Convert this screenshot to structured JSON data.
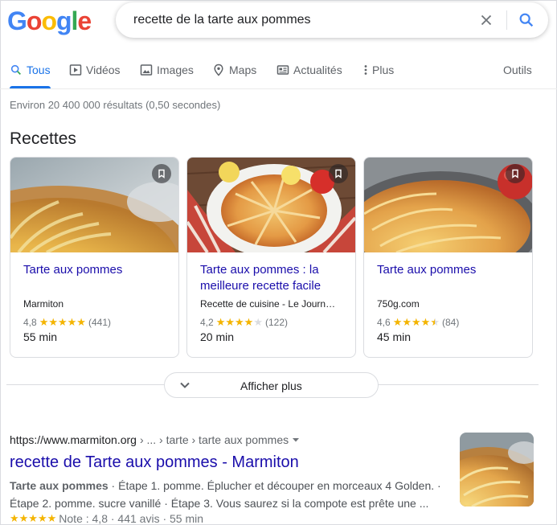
{
  "logo": {
    "letters": [
      "G",
      "o",
      "o",
      "g",
      "l",
      "e"
    ],
    "colors": [
      "#4285F4",
      "#EA4335",
      "#FBBC05",
      "#4285F4",
      "#34A853",
      "#EA4335"
    ]
  },
  "search": {
    "query": "recette de la tarte aux pommes",
    "clear_icon": "close-icon",
    "search_icon": "search-icon"
  },
  "tabs": [
    {
      "label": "Tous",
      "icon": "search-icon",
      "active": true
    },
    {
      "label": "Vidéos",
      "icon": "video-icon"
    },
    {
      "label": "Images",
      "icon": "image-icon"
    },
    {
      "label": "Maps",
      "icon": "map-pin-icon"
    },
    {
      "label": "Actualités",
      "icon": "news-icon"
    },
    {
      "label": "Plus",
      "icon": "more-vert-icon"
    },
    {
      "label": "Outils"
    }
  ],
  "result_stats": "Environ 20 400 000 résultats (0,50 secondes)",
  "recipes": {
    "title": "Recettes",
    "cards": [
      {
        "title": "Tarte aux pommes",
        "source": "Marmiton",
        "rating": "4,8",
        "stars": 4.8,
        "reviews": "(441)",
        "time": "55 min"
      },
      {
        "title": "Tarte aux pommes : la meilleure recette facile",
        "source": "Recette de cuisine - Le Journ…",
        "rating": "4,2",
        "stars": 4.2,
        "reviews": "(122)",
        "time": "20 min"
      },
      {
        "title": "Tarte aux pommes",
        "source": "750g.com",
        "rating": "4,6",
        "stars": 4.6,
        "reviews": "(84)",
        "time": "45 min"
      }
    ],
    "more_label": "Afficher plus"
  },
  "result": {
    "url": "https://www.marmiton.org",
    "breadcrumb": "› ... › tarte › tarte aux pommes",
    "title": "recette de Tarte aux pommes - Marmiton",
    "snippet_bold": "Tarte aux pommes",
    "snippet_line1": " · Étape 1. pomme. Éplucher et découper en morceaux 4 Golden. ·",
    "snippet_line2": "Étape 2. pomme. sucre vanillé · Étape 3. Vous saurez si la compote est prête une ...",
    "stars": "★★★★★",
    "meta": "Note : 4,8 · 441 avis · 55 min"
  },
  "colors": {
    "link": "#1a0dab",
    "accent": "#1a73e8",
    "star": "#f4b400"
  }
}
